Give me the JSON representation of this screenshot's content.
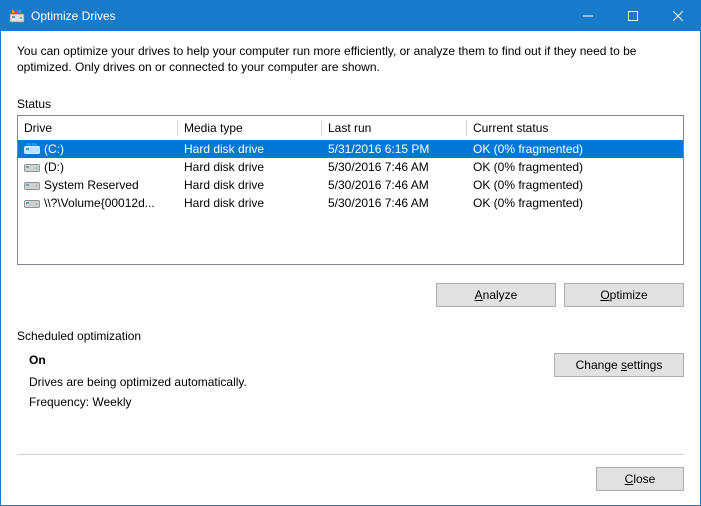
{
  "window": {
    "title": "Optimize Drives"
  },
  "description": "You can optimize your drives to help your computer run more efficiently, or analyze them to find out if they need to be optimized. Only drives on or connected to your computer are shown.",
  "status_label": "Status",
  "headers": {
    "drive": "Drive",
    "media": "Media type",
    "lastrun": "Last run",
    "status": "Current status"
  },
  "rows": [
    {
      "drive": "(C:)",
      "media": "Hard disk drive",
      "lastrun": "5/31/2016 6:15 PM",
      "status": "OK (0% fragmented)",
      "selected": true,
      "icon": "os"
    },
    {
      "drive": "(D:)",
      "media": "Hard disk drive",
      "lastrun": "5/30/2016 7:46 AM",
      "status": "OK (0% fragmented)",
      "selected": false,
      "icon": "drive"
    },
    {
      "drive": "System Reserved",
      "media": "Hard disk drive",
      "lastrun": "5/30/2016 7:46 AM",
      "status": "OK (0% fragmented)",
      "selected": false,
      "icon": "drive"
    },
    {
      "drive": "\\\\?\\Volume{00012d...",
      "media": "Hard disk drive",
      "lastrun": "5/30/2016 7:46 AM",
      "status": "OK (0% fragmented)",
      "selected": false,
      "icon": "drive"
    }
  ],
  "buttons": {
    "analyze_pre": "",
    "analyze_u": "A",
    "analyze_post": "nalyze",
    "optimize_pre": "",
    "optimize_u": "O",
    "optimize_post": "ptimize",
    "changesettings_pre": "Change ",
    "changesettings_u": "s",
    "changesettings_post": "ettings",
    "close_pre": "",
    "close_u": "C",
    "close_post": "lose"
  },
  "sched": {
    "label": "Scheduled optimization",
    "on": "On",
    "line1": "Drives are being optimized automatically.",
    "line2": "Frequency: Weekly"
  }
}
